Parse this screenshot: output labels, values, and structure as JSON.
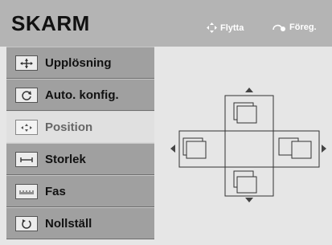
{
  "header": {
    "title": "SKARM",
    "hint_move_label": "Flytta",
    "hint_prev_label": "Föreg."
  },
  "menu": {
    "items": [
      {
        "label": "Upplösning",
        "icon": "resolution-icon"
      },
      {
        "label": "Auto. konfig.",
        "icon": "auto-config-icon"
      },
      {
        "label": "Position",
        "icon": "position-icon",
        "selected": true
      },
      {
        "label": "Storlek",
        "icon": "size-icon"
      },
      {
        "label": "Fas",
        "icon": "phase-icon"
      },
      {
        "label": "Nollställ",
        "icon": "reset-icon"
      }
    ]
  },
  "colors": {
    "header_bg": "#b4b4b4",
    "menu_item_bg": "#a0a0a0",
    "menu_item_active_bg": "#e0e0e0",
    "panel_bg": "#e6e6e6"
  }
}
